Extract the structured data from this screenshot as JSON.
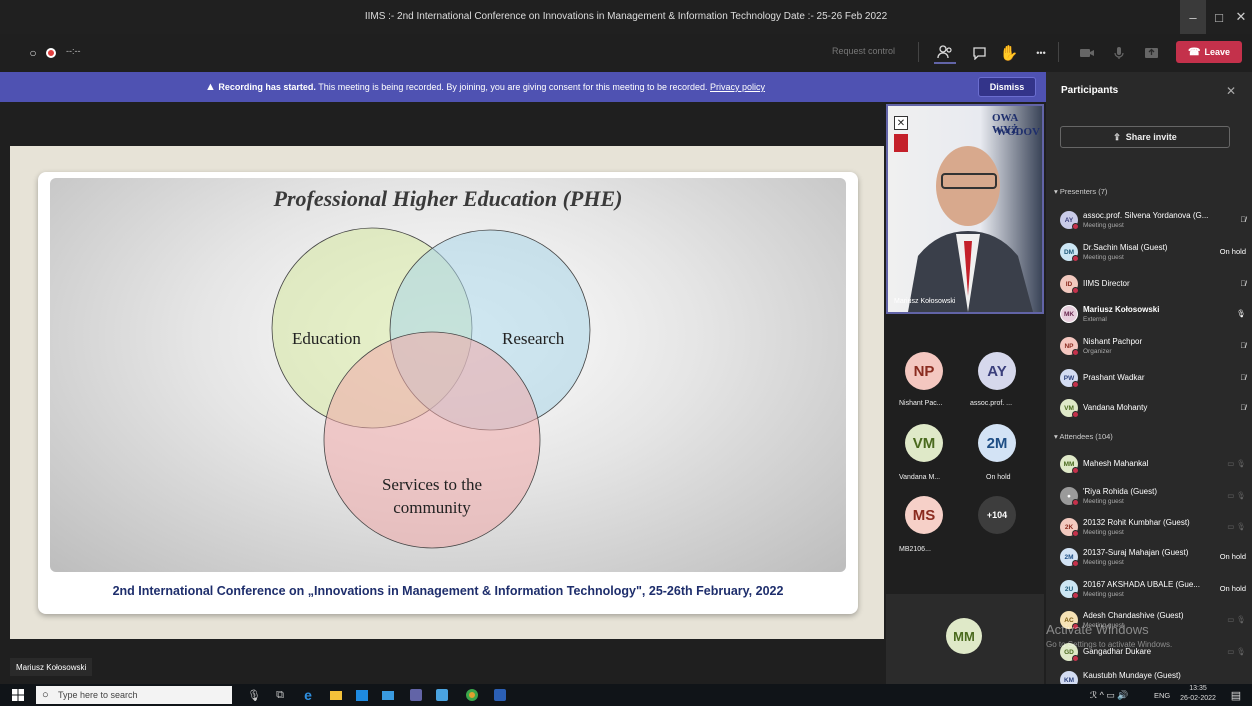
{
  "window": {
    "title": "IIMS :- 2nd International Conference on Innovations in Management & Information Technology Date :- 25-26 Feb 2022",
    "minimize": "–",
    "maximize": "□",
    "close": "✕"
  },
  "toolbar": {
    "timer": "--:--",
    "request_control": "Request control",
    "leave_label": "Leave",
    "more": "•••"
  },
  "banner": {
    "bold": "Recording has started.",
    "text": " This meeting is being recorded. By joining, you are giving consent for this meeting to be recorded. ",
    "link": "Privacy policy",
    "dismiss": "Dismiss"
  },
  "slide": {
    "title": "Professional Higher Education (PHE)",
    "venn": {
      "a": "Education",
      "b": "Research",
      "c1": "Services to the",
      "c2": "community"
    },
    "footer": "2nd International Conference on „Innovations in Management & Information Technology\", 25-26th February, 2022"
  },
  "presenter_label": "Mariusz Kołosowski",
  "video": {
    "name": "Mariusz Kołosowski",
    "bg_text1": "OWA WYŻ",
    "bg_text2": "WODOV"
  },
  "tiles": [
    {
      "initials": "NP",
      "label": "Nishant Pac...",
      "color": "#f4c7c0",
      "text_color": "#8a2b1f"
    },
    {
      "initials": "AY",
      "label": "assoc.prof. ...",
      "color": "#d6d8ec",
      "text_color": "#3b3f7c"
    },
    {
      "initials": "VM",
      "label": "Vandana M...",
      "color": "#dfe9c8",
      "text_color": "#4a6a1e"
    },
    {
      "initials": "2M",
      "label": "On hold",
      "color": "#d3e3f5",
      "text_color": "#1e4e85"
    },
    {
      "initials": "MS",
      "label": "MB2106...",
      "color": "#f6d0c8",
      "text_color": "#8a2b1f"
    },
    {
      "initials": "+104",
      "label": "",
      "color": "#3d3d3d",
      "text_color": "#ffffff"
    }
  ],
  "bottom_tile": {
    "initials": "MM"
  },
  "panel": {
    "title": "Participants",
    "share": "Share invite",
    "presenters_header": "Presenters (7)",
    "attendees_header": "Attendees (104)",
    "presenters": [
      {
        "initials": "AY",
        "name": "assoc.prof. Silvena Yordanova (G...",
        "sub": "Meeting guest",
        "status": "",
        "color": "#c9cbe8",
        "tc": "#3b3f7c"
      },
      {
        "initials": "DM",
        "name": "Dr.Sachin Misal (Guest)",
        "sub": "Meeting guest",
        "status": "On hold",
        "color": "#cce6f4",
        "tc": "#1e5a7a"
      },
      {
        "initials": "ID",
        "name": "IIMS Director",
        "sub": "",
        "status": "",
        "color": "#f2c9bf",
        "tc": "#8a2b1f"
      },
      {
        "initials": "MK",
        "name": "Mariusz Kołosowski",
        "sub": "External",
        "status": "",
        "color": "#e8d0de",
        "tc": "#6b2a52"
      },
      {
        "initials": "NP",
        "name": "Nishant Pachpor",
        "sub": "Organizer",
        "status": "",
        "color": "#f4c7c0",
        "tc": "#8a2b1f"
      },
      {
        "initials": "PW",
        "name": "Prashant Wadkar",
        "sub": "",
        "status": "",
        "color": "#d3dcf2",
        "tc": "#2a3f7a"
      },
      {
        "initials": "VM",
        "name": "Vandana Mohanty",
        "sub": "",
        "status": "",
        "color": "#dfe9c8",
        "tc": "#4a6a1e"
      }
    ],
    "attendees": [
      {
        "initials": "MM",
        "name": "Mahesh Mahankal",
        "sub": "",
        "status": "",
        "color": "#dfe9c8",
        "tc": "#4a6a1e"
      },
      {
        "initials": "",
        "name": "'Riya Rohida (Guest)",
        "sub": "Meeting guest",
        "status": "",
        "color": "#9a9a9a",
        "tc": "#ffffff"
      },
      {
        "initials": "2K",
        "name": "20132 Rohit Kumbhar (Guest)",
        "sub": "Meeting guest",
        "status": "",
        "color": "#f2c9bf",
        "tc": "#8a2b1f"
      },
      {
        "initials": "2M",
        "name": "20137-Suraj Mahajan (Guest)",
        "sub": "Meeting guest",
        "status": "On hold",
        "color": "#d3e3f5",
        "tc": "#1e4e85"
      },
      {
        "initials": "2U",
        "name": "20167 AKSHADA UBALE (Gue...",
        "sub": "Meeting guest",
        "status": "On hold",
        "color": "#cce6f4",
        "tc": "#1e5a7a"
      },
      {
        "initials": "AC",
        "name": "Adesh Chandashive (Guest)",
        "sub": "Meeting guest",
        "status": "",
        "color": "#f6e2b5",
        "tc": "#7a5a12"
      },
      {
        "initials": "GD",
        "name": "Gangadhar Dukare",
        "sub": "",
        "status": "",
        "color": "#dfe9c8",
        "tc": "#4a6a1e"
      },
      {
        "initials": "KM",
        "name": "Kaustubh Mundaye (Guest)",
        "sub": "",
        "status": "",
        "color": "#d3dcf2",
        "tc": "#2a3f7a"
      }
    ]
  },
  "watermark": {
    "line1": "Activate Windows",
    "line2": "Go to Settings to activate Windows."
  },
  "taskbar": {
    "search_placeholder": "Type here to search",
    "time": "13:35",
    "date": "26-02-2022",
    "lang": "ENG"
  }
}
